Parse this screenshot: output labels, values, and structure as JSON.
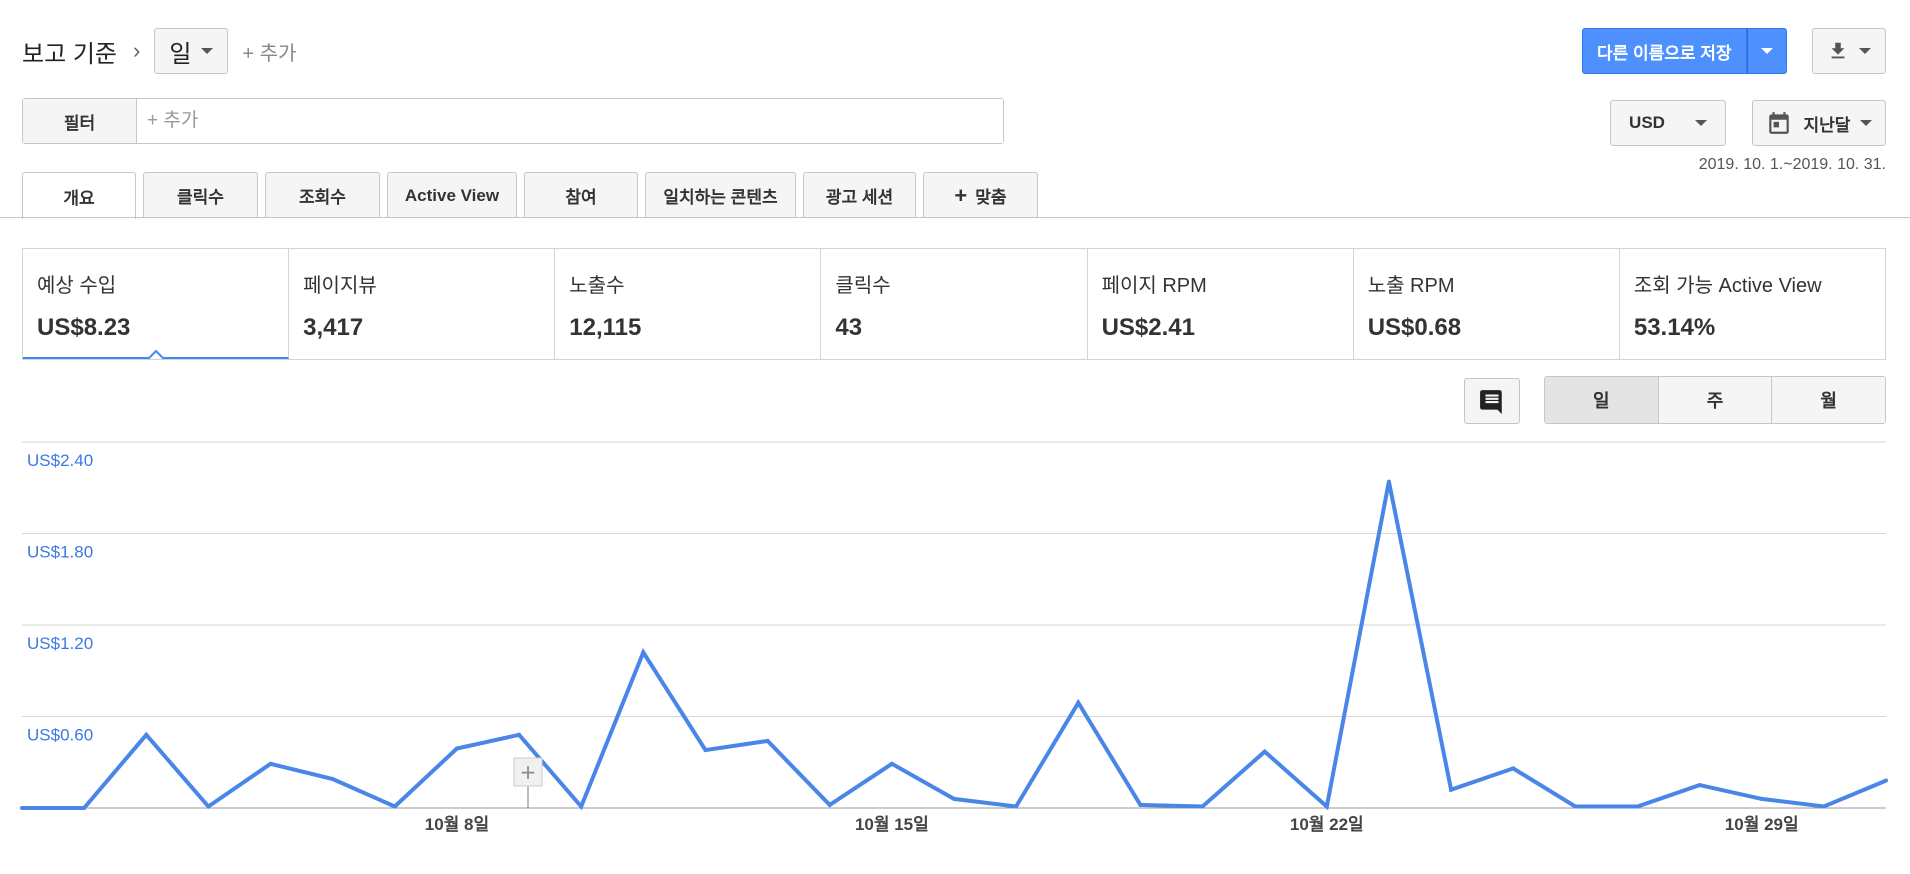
{
  "header": {
    "report_label": "보고 기준",
    "dimension_value": "일",
    "add_dimension": "+ 추가",
    "save_as_label": "다른 이름으로 저장"
  },
  "filter": {
    "button_label": "필터",
    "placeholder": "+ 추가"
  },
  "currency": {
    "label": "USD"
  },
  "date_picker": {
    "label": "지난달",
    "range": "2019. 10. 1.~2019. 10. 31."
  },
  "tabs": [
    {
      "label": "개요",
      "active": true
    },
    {
      "label": "클릭수"
    },
    {
      "label": "조회수"
    },
    {
      "label": "Active View"
    },
    {
      "label": "참여"
    },
    {
      "label": "일치하는 콘텐츠"
    },
    {
      "label": "광고 세션"
    },
    {
      "label": "맞춤"
    }
  ],
  "scorecards": [
    {
      "label": "예상 수입",
      "value": "US$8.23",
      "active": true
    },
    {
      "label": "페이지뷰",
      "value": "3,417"
    },
    {
      "label": "노출수",
      "value": "12,115"
    },
    {
      "label": "클릭수",
      "value": "43"
    },
    {
      "label": "페이지 RPM",
      "value": "US$2.41"
    },
    {
      "label": "노출 RPM",
      "value": "US$0.68"
    },
    {
      "label": "조회 가능 Active View",
      "value": "53.14%"
    }
  ],
  "granularity": {
    "options": [
      "일",
      "주",
      "월"
    ],
    "selected": "일"
  },
  "colors": {
    "accent": "#4285f4",
    "line": "#4a86e8"
  },
  "chart_data": {
    "type": "line",
    "x": [
      "10/1",
      "10/2",
      "10/3",
      "10/4",
      "10/5",
      "10/6",
      "10/7",
      "10/8",
      "10/9",
      "10/10",
      "10/11",
      "10/12",
      "10/13",
      "10/14",
      "10/15",
      "10/16",
      "10/17",
      "10/18",
      "10/19",
      "10/20",
      "10/21",
      "10/22",
      "10/23",
      "10/24",
      "10/25",
      "10/26",
      "10/27",
      "10/28",
      "10/29",
      "10/30",
      "10/31"
    ],
    "x_tick_labels": [
      {
        "index": 7,
        "label": "10월 8일"
      },
      {
        "index": 14,
        "label": "10월 15일"
      },
      {
        "index": 21,
        "label": "10월 22일"
      },
      {
        "index": 28,
        "label": "10월 29일"
      }
    ],
    "y_tick_labels": [
      "US$0.60",
      "US$1.20",
      "US$1.80",
      "US$2.40"
    ],
    "y_tick_values": [
      0.6,
      1.2,
      1.8,
      2.4
    ],
    "ylim": [
      0,
      2.4
    ],
    "series": [
      {
        "values": [
          0.0,
          0.0,
          0.48,
          0.01,
          0.29,
          0.19,
          0.01,
          0.39,
          0.48,
          0.01,
          1.02,
          0.38,
          0.44,
          0.02,
          0.29,
          0.06,
          0.01,
          0.69,
          0.02,
          0.01,
          0.37,
          0.01,
          2.14,
          0.12,
          0.26,
          0.01,
          0.01,
          0.15,
          0.06,
          0.01,
          0.18
        ]
      }
    ]
  }
}
